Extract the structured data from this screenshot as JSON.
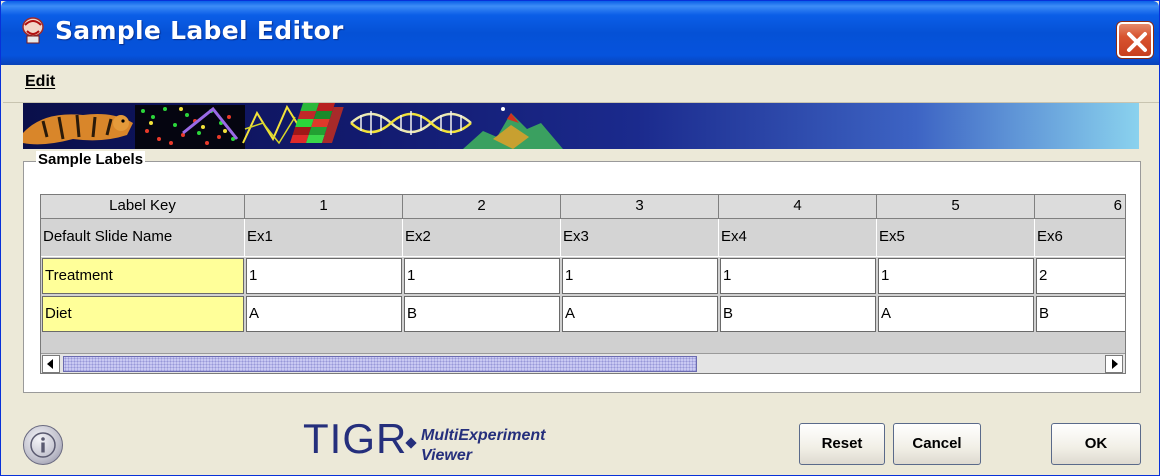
{
  "window": {
    "title": "Sample Label Editor",
    "app_icon": "tigr-mev-icon",
    "close_icon": "close-icon"
  },
  "menu": {
    "items": [
      "Edit"
    ]
  },
  "panel": {
    "title": "Sample Labels"
  },
  "table": {
    "columns": [
      "Label Key",
      "1",
      "2",
      "3",
      "4",
      "5",
      "6"
    ],
    "rows": [
      {
        "key": "Default Slide Name",
        "editable": false,
        "values": [
          "Ex1",
          "Ex2",
          "Ex3",
          "Ex4",
          "Ex5",
          "Ex6"
        ]
      },
      {
        "key": "Treatment",
        "editable": true,
        "values": [
          "1",
          "1",
          "1",
          "1",
          "1",
          "2"
        ]
      },
      {
        "key": "Diet",
        "editable": true,
        "values": [
          "A",
          "B",
          "A",
          "B",
          "A",
          "B"
        ]
      }
    ]
  },
  "logo": {
    "brand": "TIGR",
    "product_line1": "MultiExperiment",
    "product_line2": "Viewer"
  },
  "buttons": {
    "info_icon": "info-icon",
    "reset": "Reset",
    "cancel": "Cancel",
    "ok": "OK"
  },
  "colors": {
    "titlebar": "#0551d6",
    "key_cell": "#ffff99",
    "logo": "#252f7c"
  }
}
